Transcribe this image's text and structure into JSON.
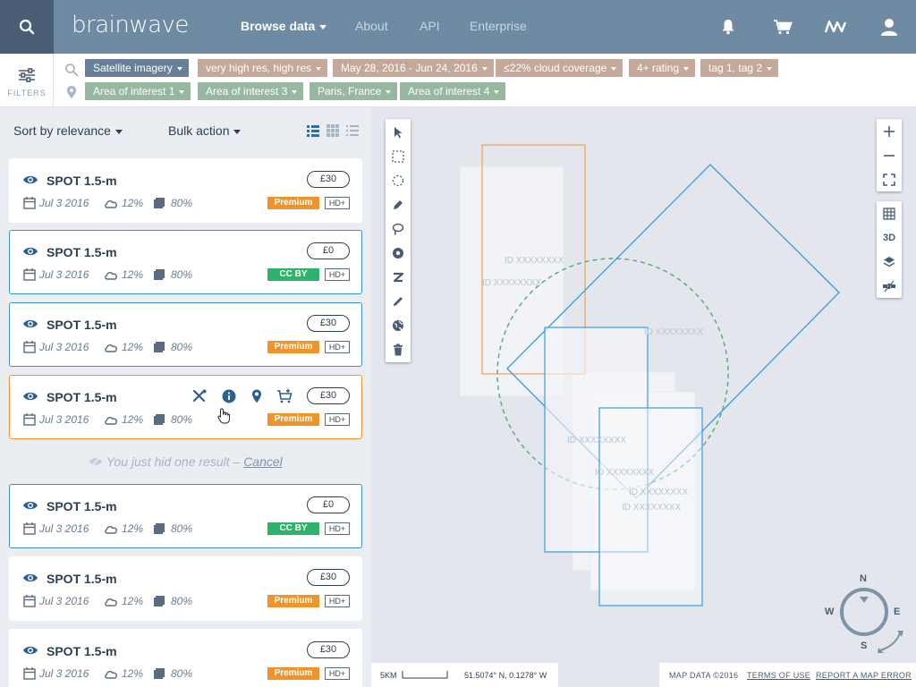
{
  "app": {
    "logo": "brainwave",
    "nav": {
      "browse": "Browse data",
      "about": "About",
      "api": "API",
      "enterprise": "Enterprise"
    }
  },
  "filters": {
    "label": "FILTERS",
    "row1": [
      "Satellite imagery",
      "very high res, high res",
      "May 28, 2016 - Jun 24, 2016",
      "≤22% cloud coverage",
      "4+ rating",
      "tag 1, tag 2"
    ],
    "row2": [
      "Area of interest 1",
      "Area of interest 3",
      "Paris, France",
      "Area of interest 4"
    ]
  },
  "list": {
    "sort_label": "Sort by relevance",
    "bulk_label": "Bulk action",
    "hidden_note": "You just hid one result –",
    "cancel_label": "Cancel",
    "results": [
      {
        "title": "SPOT 1.5-m",
        "date": "Jul 3 2016",
        "cloud": "12%",
        "coverage": "80%",
        "price": "£30",
        "license": "Premium",
        "quality": "HD+"
      },
      {
        "title": "SPOT 1.5-m",
        "date": "Jul 3 2016",
        "cloud": "12%",
        "coverage": "80%",
        "price": "£0",
        "license": "CC BY",
        "quality": "HD+"
      },
      {
        "title": "SPOT 1.5-m",
        "date": "Jul 3 2016",
        "cloud": "12%",
        "coverage": "80%",
        "price": "£30",
        "license": "Premium",
        "quality": "HD+"
      },
      {
        "title": "SPOT 1.5-m",
        "date": "Jul 3 2016",
        "cloud": "12%",
        "coverage": "80%",
        "price": "£30",
        "license": "Premium",
        "quality": "HD+"
      },
      {
        "title": "SPOT 1.5-m",
        "date": "Jul 3 2016",
        "cloud": "12%",
        "coverage": "80%",
        "price": "£0",
        "license": "CC BY",
        "quality": "HD+"
      },
      {
        "title": "SPOT 1.5-m",
        "date": "Jul 3 2016",
        "cloud": "12%",
        "coverage": "80%",
        "price": "£30",
        "license": "Premium",
        "quality": "HD+"
      },
      {
        "title": "SPOT 1.5-m",
        "date": "Jul 3 2016",
        "cloud": "12%",
        "coverage": "80%",
        "price": "£30",
        "license": "Premium",
        "quality": "HD+"
      }
    ]
  },
  "map": {
    "footprint_label": "ID XXXXXXXX",
    "scale": "5KM",
    "coords": "51.5074° N, 0.1278° W",
    "map_data": "MAP DATA ©2016",
    "terms": "TERMS OF USE",
    "report": "REPORT A MAP ERROR",
    "three_d": "3D",
    "compass": {
      "n": "N",
      "s": "S",
      "e": "E",
      "w": "W"
    }
  },
  "colors": {
    "topbar": "#6f8aa3",
    "accent_blue": "#3a8fd1",
    "accent_orange": "#f0942a",
    "premium": "#f0942a",
    "ccby": "#2db36b"
  }
}
